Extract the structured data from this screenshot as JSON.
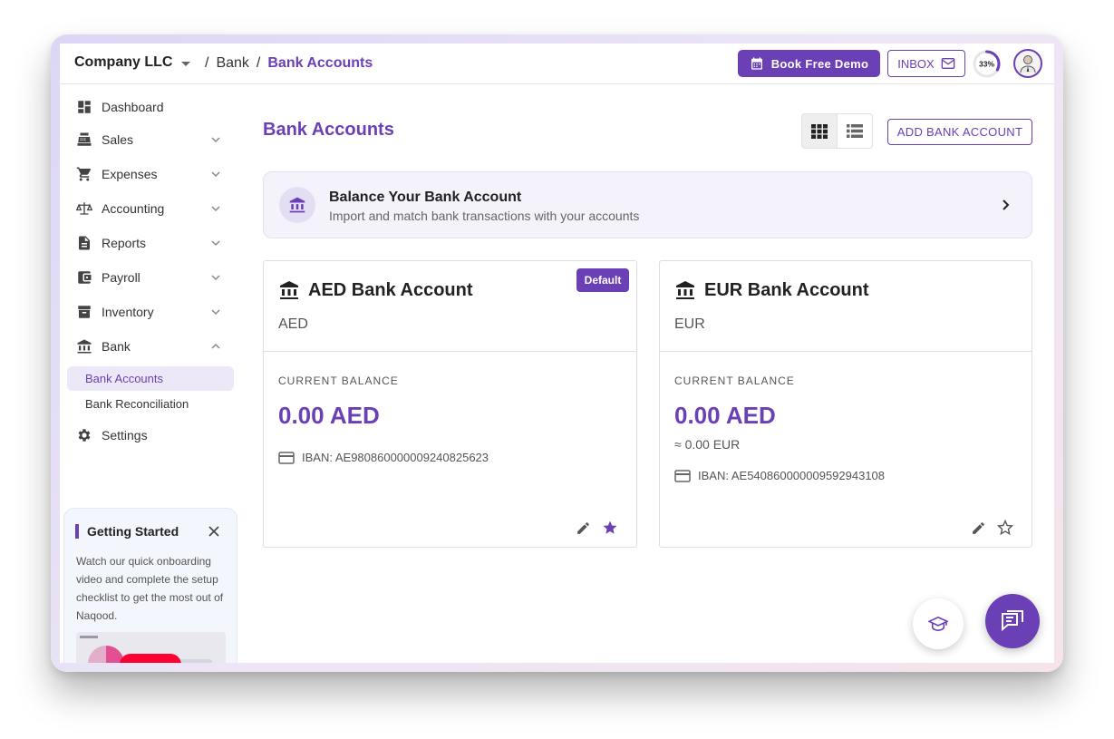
{
  "header": {
    "company": "Company LLC",
    "breadcrumb": {
      "sep": "/",
      "parent": "Bank",
      "current": "Bank Accounts"
    },
    "demo_label": "Book Free Demo",
    "inbox_label": "INBOX",
    "progress": {
      "label": "33%",
      "value": 33
    }
  },
  "sidebar": {
    "items": [
      {
        "label": "Dashboard",
        "icon": "dashboard-icon"
      },
      {
        "label": "Sales",
        "icon": "register-icon"
      },
      {
        "label": "Expenses",
        "icon": "cart-icon"
      },
      {
        "label": "Accounting",
        "icon": "scale-icon"
      },
      {
        "label": "Reports",
        "icon": "document-icon"
      },
      {
        "label": "Payroll",
        "icon": "wallet-icon"
      },
      {
        "label": "Inventory",
        "icon": "archive-icon"
      },
      {
        "label": "Bank",
        "icon": "bank-icon"
      }
    ],
    "bank_sub": [
      "Bank Accounts",
      "Bank Reconciliation"
    ],
    "settings": "Settings",
    "getting_started": {
      "title": "Getting Started",
      "text": "Watch our quick onboarding video and complete the setup checklist to get the most out of Naqood."
    }
  },
  "main": {
    "title": "Bank Accounts",
    "add_label": "ADD BANK ACCOUNT",
    "banner": {
      "title": "Balance Your Bank Account",
      "subtitle": "Import and match bank transactions with your accounts"
    },
    "accounts": [
      {
        "name": "AED Bank Account",
        "currency": "AED",
        "badge": "Default",
        "balance_label": "CURRENT BALANCE",
        "balance": "0.00 AED",
        "iban": "IBAN: AE980860000009240825623",
        "favorite": true
      },
      {
        "name": "EUR Bank Account",
        "currency": "EUR",
        "balance_label": "CURRENT BALANCE",
        "balance": "0.00 AED",
        "converted": "≈ 0.00 EUR",
        "iban": "IBAN: AE540860000009592943108",
        "favorite": false
      }
    ]
  },
  "colors": {
    "accent": "#6b3fb5",
    "border": "#dedede",
    "youtube": "#ff0033"
  }
}
